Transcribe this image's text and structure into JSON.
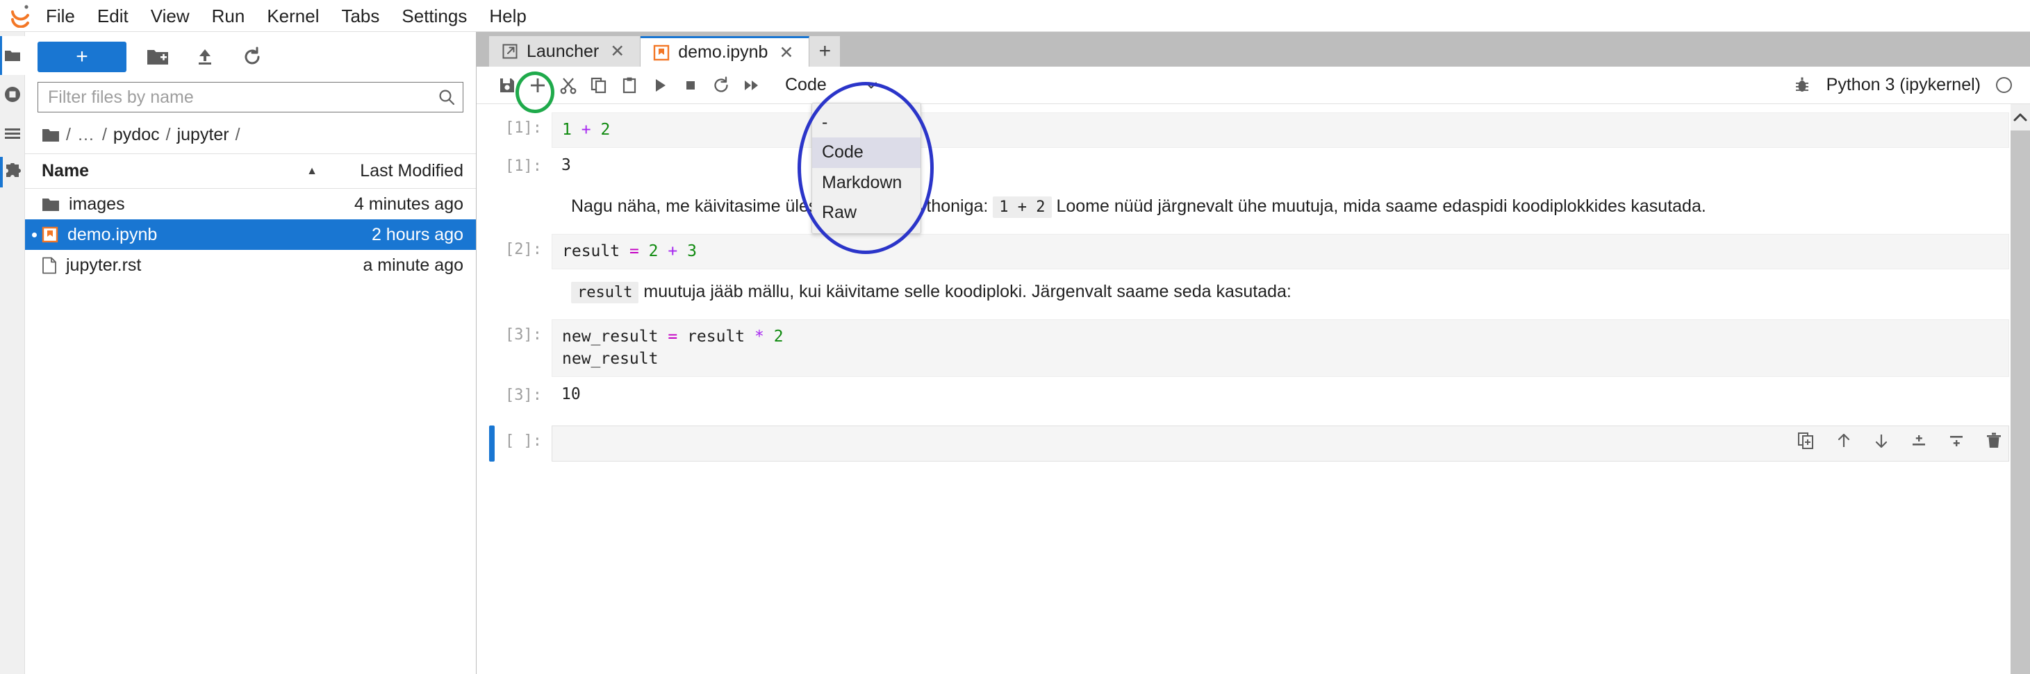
{
  "app": {
    "logo_icon": "jupyter-logo-icon"
  },
  "menubar": {
    "items": [
      {
        "label": "File"
      },
      {
        "label": "Edit"
      },
      {
        "label": "View"
      },
      {
        "label": "Run"
      },
      {
        "label": "Kernel"
      },
      {
        "label": "Tabs"
      },
      {
        "label": "Settings"
      },
      {
        "label": "Help"
      }
    ]
  },
  "activitybar": {
    "items": [
      {
        "icon": "folder-icon",
        "name": "file-browser",
        "active": true
      },
      {
        "icon": "running-kernels-icon",
        "name": "running-terminals-kernels",
        "active": false
      },
      {
        "icon": "list-icon",
        "name": "table-of-contents",
        "active": false
      },
      {
        "icon": "puzzle-icon",
        "name": "extension-manager",
        "active": false
      }
    ]
  },
  "filebrowser": {
    "toolbar": {
      "new_label": "+",
      "new_folder_icon": "new-folder-icon",
      "upload_icon": "upload-icon",
      "refresh_icon": "refresh-icon"
    },
    "filter": {
      "placeholder": "Filter files by name",
      "value": "",
      "icon": "search-icon"
    },
    "breadcrumb": {
      "folder_icon": "folder-icon",
      "parts": [
        "/",
        "…",
        "/",
        "pydoc",
        "/",
        "jupyter",
        "/"
      ]
    },
    "columns": {
      "name": "Name",
      "last_modified": "Last Modified"
    },
    "sort_caret": "▲",
    "rows": [
      {
        "icon": "folder-icon",
        "name": "images",
        "modified": "4 minutes ago",
        "selected": false,
        "running": false
      },
      {
        "icon": "notebook-icon",
        "name": "demo.ipynb",
        "modified": "2 hours ago",
        "selected": true,
        "running": true
      },
      {
        "icon": "file-icon",
        "name": "jupyter.rst",
        "modified": "a minute ago",
        "selected": false,
        "running": false
      }
    ]
  },
  "notebook": {
    "tabs": [
      {
        "label": "Launcher",
        "icon": "launcher-icon",
        "active": false,
        "close_icon": "close-icon"
      },
      {
        "label": "demo.ipynb",
        "icon": "notebook-icon",
        "active": true,
        "close_icon": "close-icon"
      }
    ],
    "tab_add_label": "+",
    "toolbar": {
      "buttons": [
        {
          "name": "save-button",
          "icon": "save-icon"
        },
        {
          "name": "insert-cell-button",
          "icon": "plus-icon"
        },
        {
          "name": "cut-cell-button",
          "icon": "scissors-icon"
        },
        {
          "name": "copy-cell-button",
          "icon": "copy-icon"
        },
        {
          "name": "paste-cell-button",
          "icon": "paste-icon"
        },
        {
          "name": "run-cell-button",
          "icon": "play-icon"
        },
        {
          "name": "stop-kernel-button",
          "icon": "stop-icon"
        },
        {
          "name": "restart-kernel-button",
          "icon": "restart-icon"
        },
        {
          "name": "restart-run-all-button",
          "icon": "fast-forward-icon"
        }
      ],
      "celltype": {
        "value": "Code",
        "chevron_icon": "chevron-down-icon",
        "options": [
          "-",
          "Code",
          "Markdown",
          "Raw"
        ],
        "hovered": "Code",
        "open": true
      },
      "debug_icon": "bug-icon",
      "kernel_name": "Python 3 (ipykernel)",
      "kernel_status_icon": "kernel-idle-circle-icon"
    },
    "cells": [
      {
        "type": "code",
        "prompt": "[1]:",
        "source_tokens": [
          {
            "t": "1",
            "c": "num"
          },
          {
            "t": " ",
            "c": ""
          },
          {
            "t": "+",
            "c": "op"
          },
          {
            "t": " ",
            "c": ""
          },
          {
            "t": "2",
            "c": "num"
          }
        ],
        "source_plain": "1 + 2"
      },
      {
        "type": "output",
        "prompt": "[1]:",
        "text": "3"
      },
      {
        "type": "markdown",
        "prompt": "",
        "segments": [
          {
            "t": "Nagu näha, me käivitasime ülesande teksti Pythoniga: ",
            "code": false
          },
          {
            "t": "1 + 2",
            "code": true
          },
          {
            "t": " Loome nüüd järgnevalt ühe muutuja, mida saame edaspidi koodiplokkides kasutada.",
            "code": false
          }
        ]
      },
      {
        "type": "code",
        "prompt": "[2]:",
        "source_tokens": [
          {
            "t": "result",
            "c": ""
          },
          {
            "t": " ",
            "c": ""
          },
          {
            "t": "=",
            "c": "eq"
          },
          {
            "t": " ",
            "c": ""
          },
          {
            "t": "2",
            "c": "num"
          },
          {
            "t": " ",
            "c": ""
          },
          {
            "t": "+",
            "c": "op"
          },
          {
            "t": " ",
            "c": ""
          },
          {
            "t": "3",
            "c": "num"
          }
        ],
        "source_plain": "result = 2 + 3"
      },
      {
        "type": "markdown",
        "prompt": "",
        "segments": [
          {
            "t": "result",
            "code": true
          },
          {
            "t": " muutuja jääb mällu, kui käivitame selle koodiploki. Järgenvalt saame seda kasutada:",
            "code": false
          }
        ]
      },
      {
        "type": "code",
        "prompt": "[3]:",
        "source_tokens": [
          {
            "t": "new_result",
            "c": ""
          },
          {
            "t": " ",
            "c": ""
          },
          {
            "t": "=",
            "c": "eq"
          },
          {
            "t": " ",
            "c": ""
          },
          {
            "t": "result",
            "c": ""
          },
          {
            "t": " ",
            "c": ""
          },
          {
            "t": "*",
            "c": "op"
          },
          {
            "t": " ",
            "c": ""
          },
          {
            "t": "2",
            "c": "num"
          },
          {
            "t": "\n",
            "c": ""
          },
          {
            "t": "new_result",
            "c": ""
          }
        ],
        "source_plain": "new_result = result * 2\nnew_result"
      },
      {
        "type": "output",
        "prompt": "[3]:",
        "text": "10"
      },
      {
        "type": "empty",
        "prompt": "[ ]:",
        "active": true,
        "source_plain": ""
      }
    ],
    "cell_actions": [
      {
        "name": "duplicate-cell-button",
        "icon": "duplicate-icon"
      },
      {
        "name": "move-cell-up-button",
        "icon": "arrow-up-icon"
      },
      {
        "name": "move-cell-down-button",
        "icon": "arrow-down-icon"
      },
      {
        "name": "insert-cell-above-button",
        "icon": "insert-above-icon"
      },
      {
        "name": "insert-cell-below-button",
        "icon": "insert-below-icon"
      },
      {
        "name": "delete-cell-button",
        "icon": "trash-icon"
      }
    ],
    "scroll_up_icon": "chevron-up-icon"
  },
  "annotations": [
    {
      "name": "green-ellipse-insert-cell",
      "color": "#1faa4b",
      "shape": "ellipse"
    },
    {
      "name": "blue-ellipse-celltype-dropdown",
      "color": "#2b35c9",
      "shape": "ellipse"
    }
  ],
  "colors": {
    "accent": "#1976d2",
    "annotation_green": "#1faa4b",
    "annotation_blue": "#2b35c9",
    "notebook_orange": "#f37726"
  }
}
